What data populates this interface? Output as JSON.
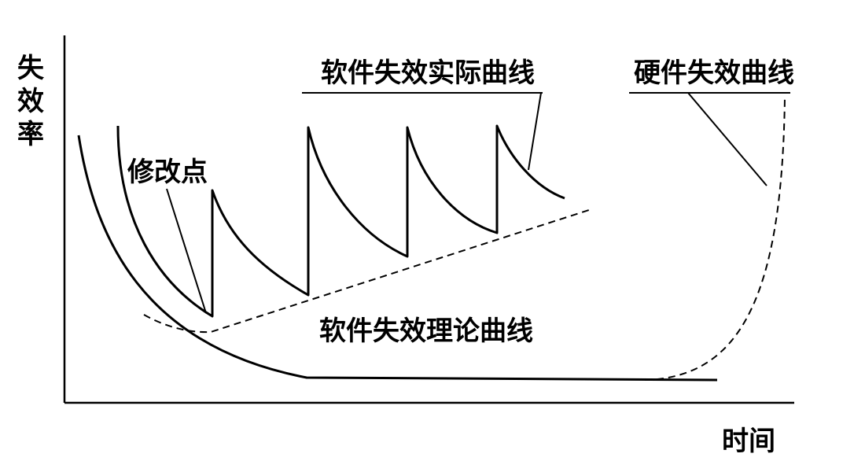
{
  "y_axis_label": [
    "失",
    "效",
    "率"
  ],
  "x_axis_label": "时间",
  "labels": {
    "software_actual": "软件失效实际曲线",
    "hardware": "硬件失效曲线",
    "modification_point": "修改点",
    "software_theoretical": "软件失效理论曲线"
  }
}
